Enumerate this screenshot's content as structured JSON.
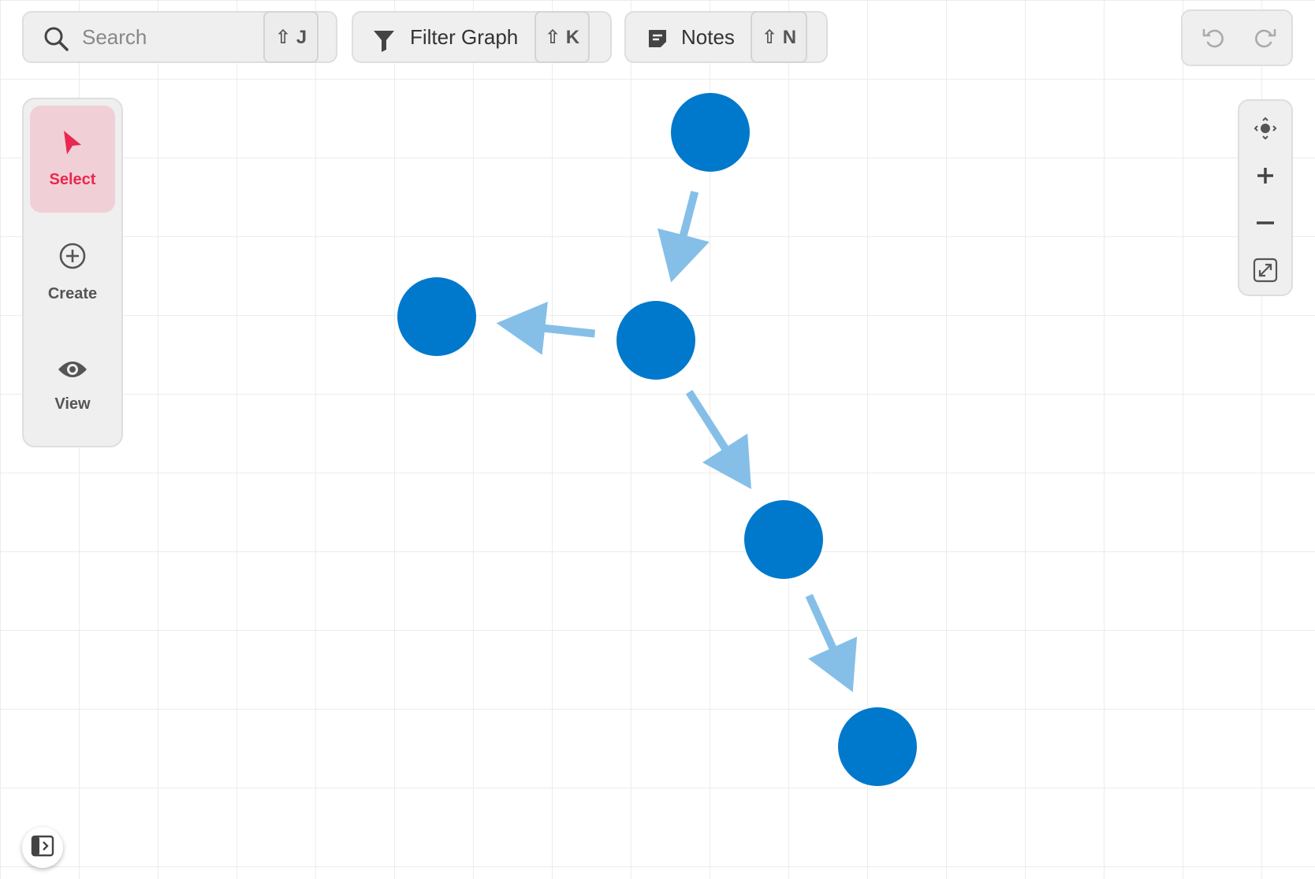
{
  "toolbar": {
    "search": {
      "placeholder": "Search",
      "shortcut": "⇧ J"
    },
    "filter": {
      "label": "Filter Graph",
      "shortcut": "⇧ K"
    },
    "notes": {
      "label": "Notes",
      "shortcut": "⇧ N"
    }
  },
  "tools": [
    {
      "label": "Select",
      "icon": "cursor-arrow-icon",
      "active": true
    },
    {
      "label": "Create",
      "icon": "plus-circle-icon",
      "active": false
    },
    {
      "label": "View",
      "icon": "eye-icon",
      "active": false
    }
  ],
  "zoom_controls": [
    "recenter-icon",
    "zoom-in-icon",
    "zoom-out-icon",
    "fit-screen-icon"
  ],
  "history": [
    "undo-icon",
    "redo-icon"
  ],
  "graph": {
    "nodes": [
      {
        "id": "n1"
      },
      {
        "id": "n2"
      },
      {
        "id": "n3"
      },
      {
        "id": "n4"
      },
      {
        "id": "n5"
      }
    ],
    "edges": [
      {
        "from": "n1",
        "to": "n2"
      },
      {
        "from": "n2",
        "to": "n3"
      },
      {
        "from": "n2",
        "to": "n4"
      },
      {
        "from": "n4",
        "to": "n5"
      }
    ]
  },
  "colors": {
    "node": "#0079cc",
    "edge": "#85bfe8",
    "accent": "#e8294f",
    "active_tool_bg": "#f1cfd7"
  }
}
